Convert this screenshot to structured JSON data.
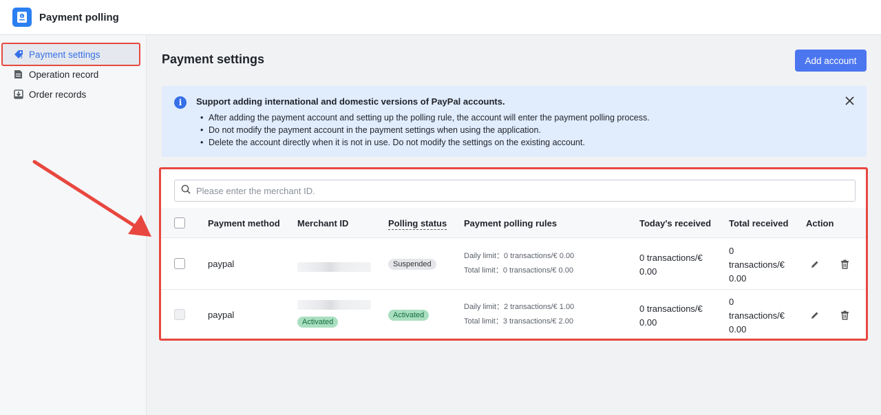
{
  "app": {
    "title": "Payment polling"
  },
  "sidebar": {
    "items": [
      {
        "label": "Payment settings",
        "icon": "tag-icon",
        "active": true
      },
      {
        "label": "Operation record",
        "icon": "document-icon",
        "active": false
      },
      {
        "label": "Order records",
        "icon": "download-box-icon",
        "active": false
      }
    ]
  },
  "main": {
    "title": "Payment settings",
    "add_button": "Add account"
  },
  "notice": {
    "title": "Support adding international and domestic versions of PayPal accounts.",
    "items": [
      "After adding the payment account and setting up the polling rule, the account will enter the payment polling process.",
      "Do not modify the payment account in the payment settings when using the application.",
      "Delete the account directly when it is not in use. Do not modify the settings on the existing account."
    ]
  },
  "search": {
    "placeholder": "Please enter the merchant ID."
  },
  "table": {
    "headers": {
      "method": "Payment method",
      "merchant": "Merchant ID",
      "status": "Polling status",
      "rules": "Payment polling rules",
      "today": "Today's received",
      "total": "Total received",
      "action": "Action"
    },
    "rows": [
      {
        "method": "paypal",
        "merchant_badge": "",
        "status": "Suspended",
        "daily": "Daily limit：0 transactions/€ 0.00",
        "total_limit": "Total limit：0 transactions/€ 0.00",
        "today_a": "0 transactions/€",
        "today_b": "0.00",
        "total_a": "0",
        "total_b": "transactions/€",
        "total_c": "0.00"
      },
      {
        "method": "paypal",
        "merchant_badge": "Activated",
        "status": "Activated",
        "daily": "Daily limit：2 transactions/€ 1.00",
        "total_limit": "Total limit：3 transactions/€ 2.00",
        "today_a": "0 transactions/€",
        "today_b": "0.00",
        "total_a": "0",
        "total_b": "transactions/€",
        "total_c": "0.00"
      }
    ]
  },
  "colors": {
    "accent": "#4c76f0",
    "highlight": "#e8473f",
    "notice_bg": "#e1ecfd",
    "active_badge": "#a9dfc0"
  }
}
